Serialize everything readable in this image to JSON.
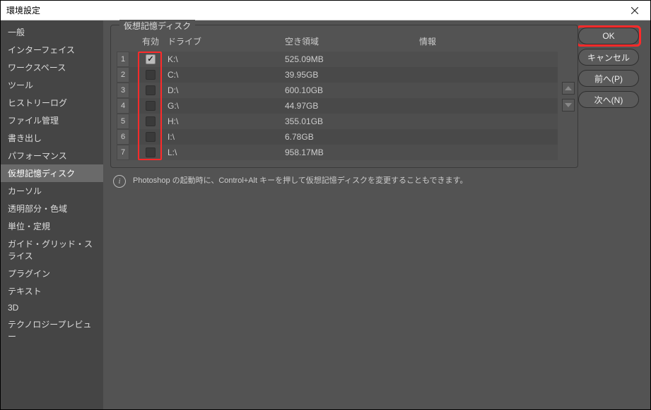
{
  "window": {
    "title": "環境設定"
  },
  "sidebar": {
    "items": [
      "一般",
      "インターフェイス",
      "ワークスペース",
      "ツール",
      "ヒストリーログ",
      "ファイル管理",
      "書き出し",
      "パフォーマンス",
      "仮想記憶ディスク",
      "カーソル",
      "透明部分・色域",
      "単位・定規",
      "ガイド・グリッド・スライス",
      "プラグイン",
      "テキスト",
      "3D",
      "テクノロジープレビュー"
    ],
    "selected_index": 8
  },
  "panel": {
    "title": "仮想記憶ディスク",
    "headers": {
      "active": "有効",
      "drive": "ドライブ",
      "free": "空き領域",
      "info": "情報"
    },
    "rows": [
      {
        "num": "1",
        "checked": true,
        "drive": "K:\\",
        "free": "525.09MB",
        "info": ""
      },
      {
        "num": "2",
        "checked": false,
        "drive": "C:\\",
        "free": "39.95GB",
        "info": ""
      },
      {
        "num": "3",
        "checked": false,
        "drive": "D:\\",
        "free": "600.10GB",
        "info": ""
      },
      {
        "num": "4",
        "checked": false,
        "drive": "G:\\",
        "free": "44.97GB",
        "info": ""
      },
      {
        "num": "5",
        "checked": false,
        "drive": "H:\\",
        "free": "355.01GB",
        "info": ""
      },
      {
        "num": "6",
        "checked": false,
        "drive": "I:\\",
        "free": "6.78GB",
        "info": ""
      },
      {
        "num": "7",
        "checked": false,
        "drive": "L:\\",
        "free": "958.17MB",
        "info": ""
      }
    ],
    "note": "Photoshop の起動時に、Control+Alt キーを押して仮想記憶ディスクを変更することもできます。"
  },
  "buttons": {
    "ok": "OK",
    "cancel": "キャンセル",
    "prev": "前へ(P)",
    "next": "次へ(N)"
  }
}
